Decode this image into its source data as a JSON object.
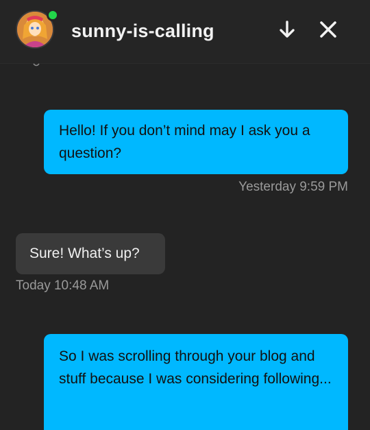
{
  "header": {
    "username": "sunny-is-calling",
    "online": true,
    "colors": {
      "background": "#252525",
      "online_dot": "#22d64a"
    },
    "icons": [
      "chevron-down-icon",
      "close-icon"
    ]
  },
  "conversation": {
    "messages": [
      {
        "direction": "sent",
        "text": "Hello! If you don’t mind may I ask you a question?",
        "timestamp": "Yesterday 9:59 PM"
      },
      {
        "direction": "received",
        "text": "Sure! What’s up?",
        "timestamp": "Today 10:48 AM"
      },
      {
        "direction": "sent",
        "text": "So I was scrolling through your blog and stuff because I was considering following...",
        "timestamp": ""
      }
    ],
    "colors": {
      "sent_bubble": "#00b8ff",
      "received_bubble": "#3a3a3a",
      "background": "#232323",
      "timestamp": "#9a9a9a"
    }
  }
}
